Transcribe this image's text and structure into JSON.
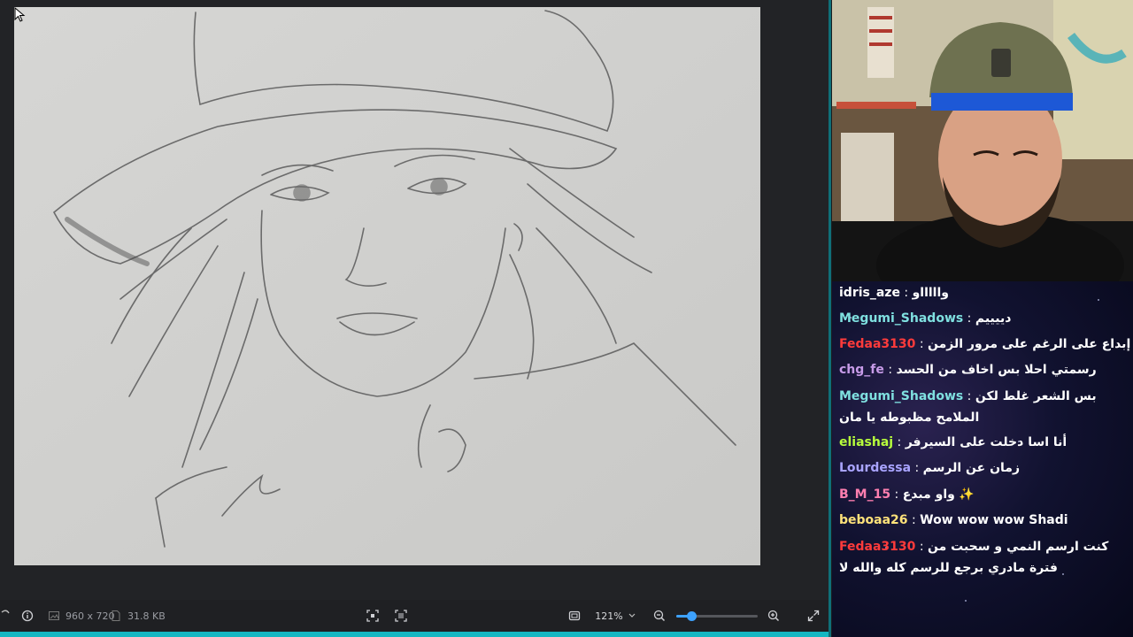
{
  "viewer": {
    "image_dimensions": "960 x 720",
    "file_size": "31.8 KB",
    "zoom_level": "121%",
    "zoom_slider_fraction": 0.18
  },
  "chat": {
    "messages": [
      {
        "user": "idris_aze",
        "color": "#ffffff",
        "text": "واااااو",
        "badge": ""
      },
      {
        "user": "Megumi_Shadows",
        "color": "#7fe0e0",
        "text": "دييييم",
        "badge": ""
      },
      {
        "user": "Fedaa3130",
        "color": "#ff3b3b",
        "text": "هممم, إبداع على الرغم على مرور الزمن",
        "badge": "✨"
      },
      {
        "user": "chg_fe",
        "color": "#c79be8",
        "text": "رسمتي احلا بس اخاف من الحسد",
        "badge": ""
      },
      {
        "user": "Megumi_Shadows",
        "color": "#7fe0e0",
        "text": "بس الشعر غلط لكن الملامح مظبوطه يا مان",
        "badge": ""
      },
      {
        "user": "eliashaj",
        "color": "#b8ff3c",
        "text": "أنا اسا دخلت على السيرفر",
        "badge": ""
      },
      {
        "user": "Lourdessa",
        "color": "#a9a4ff",
        "text": "زمان عن الرسم",
        "badge": ""
      },
      {
        "user": "B_M_15",
        "color": "#ff7fb0",
        "text": "واو مبدع",
        "badge": "✨"
      },
      {
        "user": "beboaa26",
        "color": "#ffe27a",
        "text": "Wow wow wow Shadi",
        "badge": ""
      },
      {
        "user": "Fedaa3130",
        "color": "#ff3b3b",
        "text": "كنت ارسم النمي و سحبت من فترة مادري برجع للرسم كله والله لا",
        "badge": ""
      }
    ]
  },
  "colors": {
    "accent": "#3da2ff",
    "stream_border": "#15b7c2"
  }
}
